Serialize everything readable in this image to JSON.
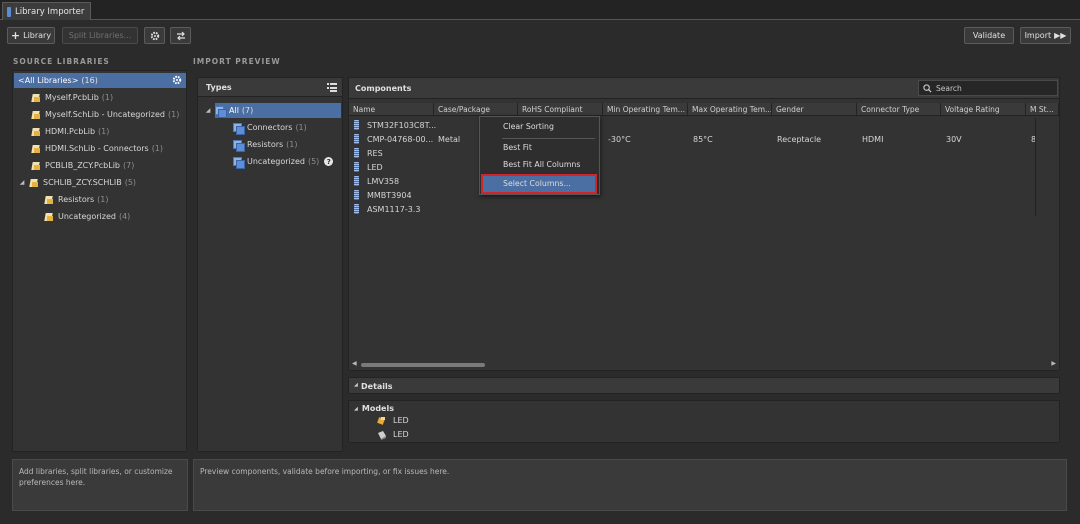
{
  "app": {
    "tab_title": "Library Importer"
  },
  "toolbar": {
    "library_label": "Library",
    "split_label": "Split Libraries...",
    "validate_label": "Validate",
    "import_label": "Import"
  },
  "source": {
    "section_title": "SOURCE LIBRARIES",
    "items": [
      {
        "label": "<All Libraries>",
        "count": "(16)"
      },
      {
        "label": "Myself.PcbLib",
        "count": "(1)"
      },
      {
        "label": "Myself.SchLib - Uncategorized",
        "count": "(1)"
      },
      {
        "label": "HDMI.PcbLib",
        "count": "(1)"
      },
      {
        "label": "HDMI.SchLib - Connectors",
        "count": "(1)"
      },
      {
        "label": "PCBLIB_ZCY.PcbLib",
        "count": "(7)"
      },
      {
        "label": "SCHLIB_ZCY.SCHLIB",
        "count": "(5)"
      },
      {
        "label": "Resistors",
        "count": "(1)"
      },
      {
        "label": "Uncategorized",
        "count": "(4)"
      }
    ],
    "hint": "Add libraries, split libraries, or customize preferences here."
  },
  "preview": {
    "section_title": "IMPORT PREVIEW",
    "types_title": "Types",
    "types": [
      {
        "label": "All",
        "count": "(7)"
      },
      {
        "label": "Connectors",
        "count": "(1)"
      },
      {
        "label": "Resistors",
        "count": "(1)"
      },
      {
        "label": "Uncategorized",
        "count": "(5)"
      }
    ],
    "components_title": "Components",
    "search_placeholder": "Search",
    "columns": [
      "Name",
      "Case/Package",
      "RoHS Compliant",
      "Min Operating Tem...",
      "Max Operating Tem...",
      "Gender",
      "Connector Type",
      "Voltage Rating",
      "M St..."
    ],
    "rows": [
      {
        "name": "STM32F103C8T..."
      },
      {
        "name": "CMP-04768-00...",
        "case": "Metal",
        "min_temp": "-30°C",
        "max_temp": "85°C",
        "gender": "Receptacle",
        "connector": "HDMI",
        "voltage": "30V",
        "m": "8"
      },
      {
        "name": "RES"
      },
      {
        "name": "LED"
      },
      {
        "name": "LMV358"
      },
      {
        "name": "MMBT3904"
      },
      {
        "name": "ASM1117-3.3"
      }
    ],
    "context_menu": [
      "Clear Sorting",
      "Best Fit",
      "Best Fit All Columns",
      "Select Columns..."
    ],
    "details_title": "Details",
    "models_title": "Models",
    "models": [
      {
        "label": "LED",
        "kind": "footprint"
      },
      {
        "label": "LED",
        "kind": "symbol"
      }
    ],
    "hint": "Preview components, validate before importing, or fix issues here."
  }
}
